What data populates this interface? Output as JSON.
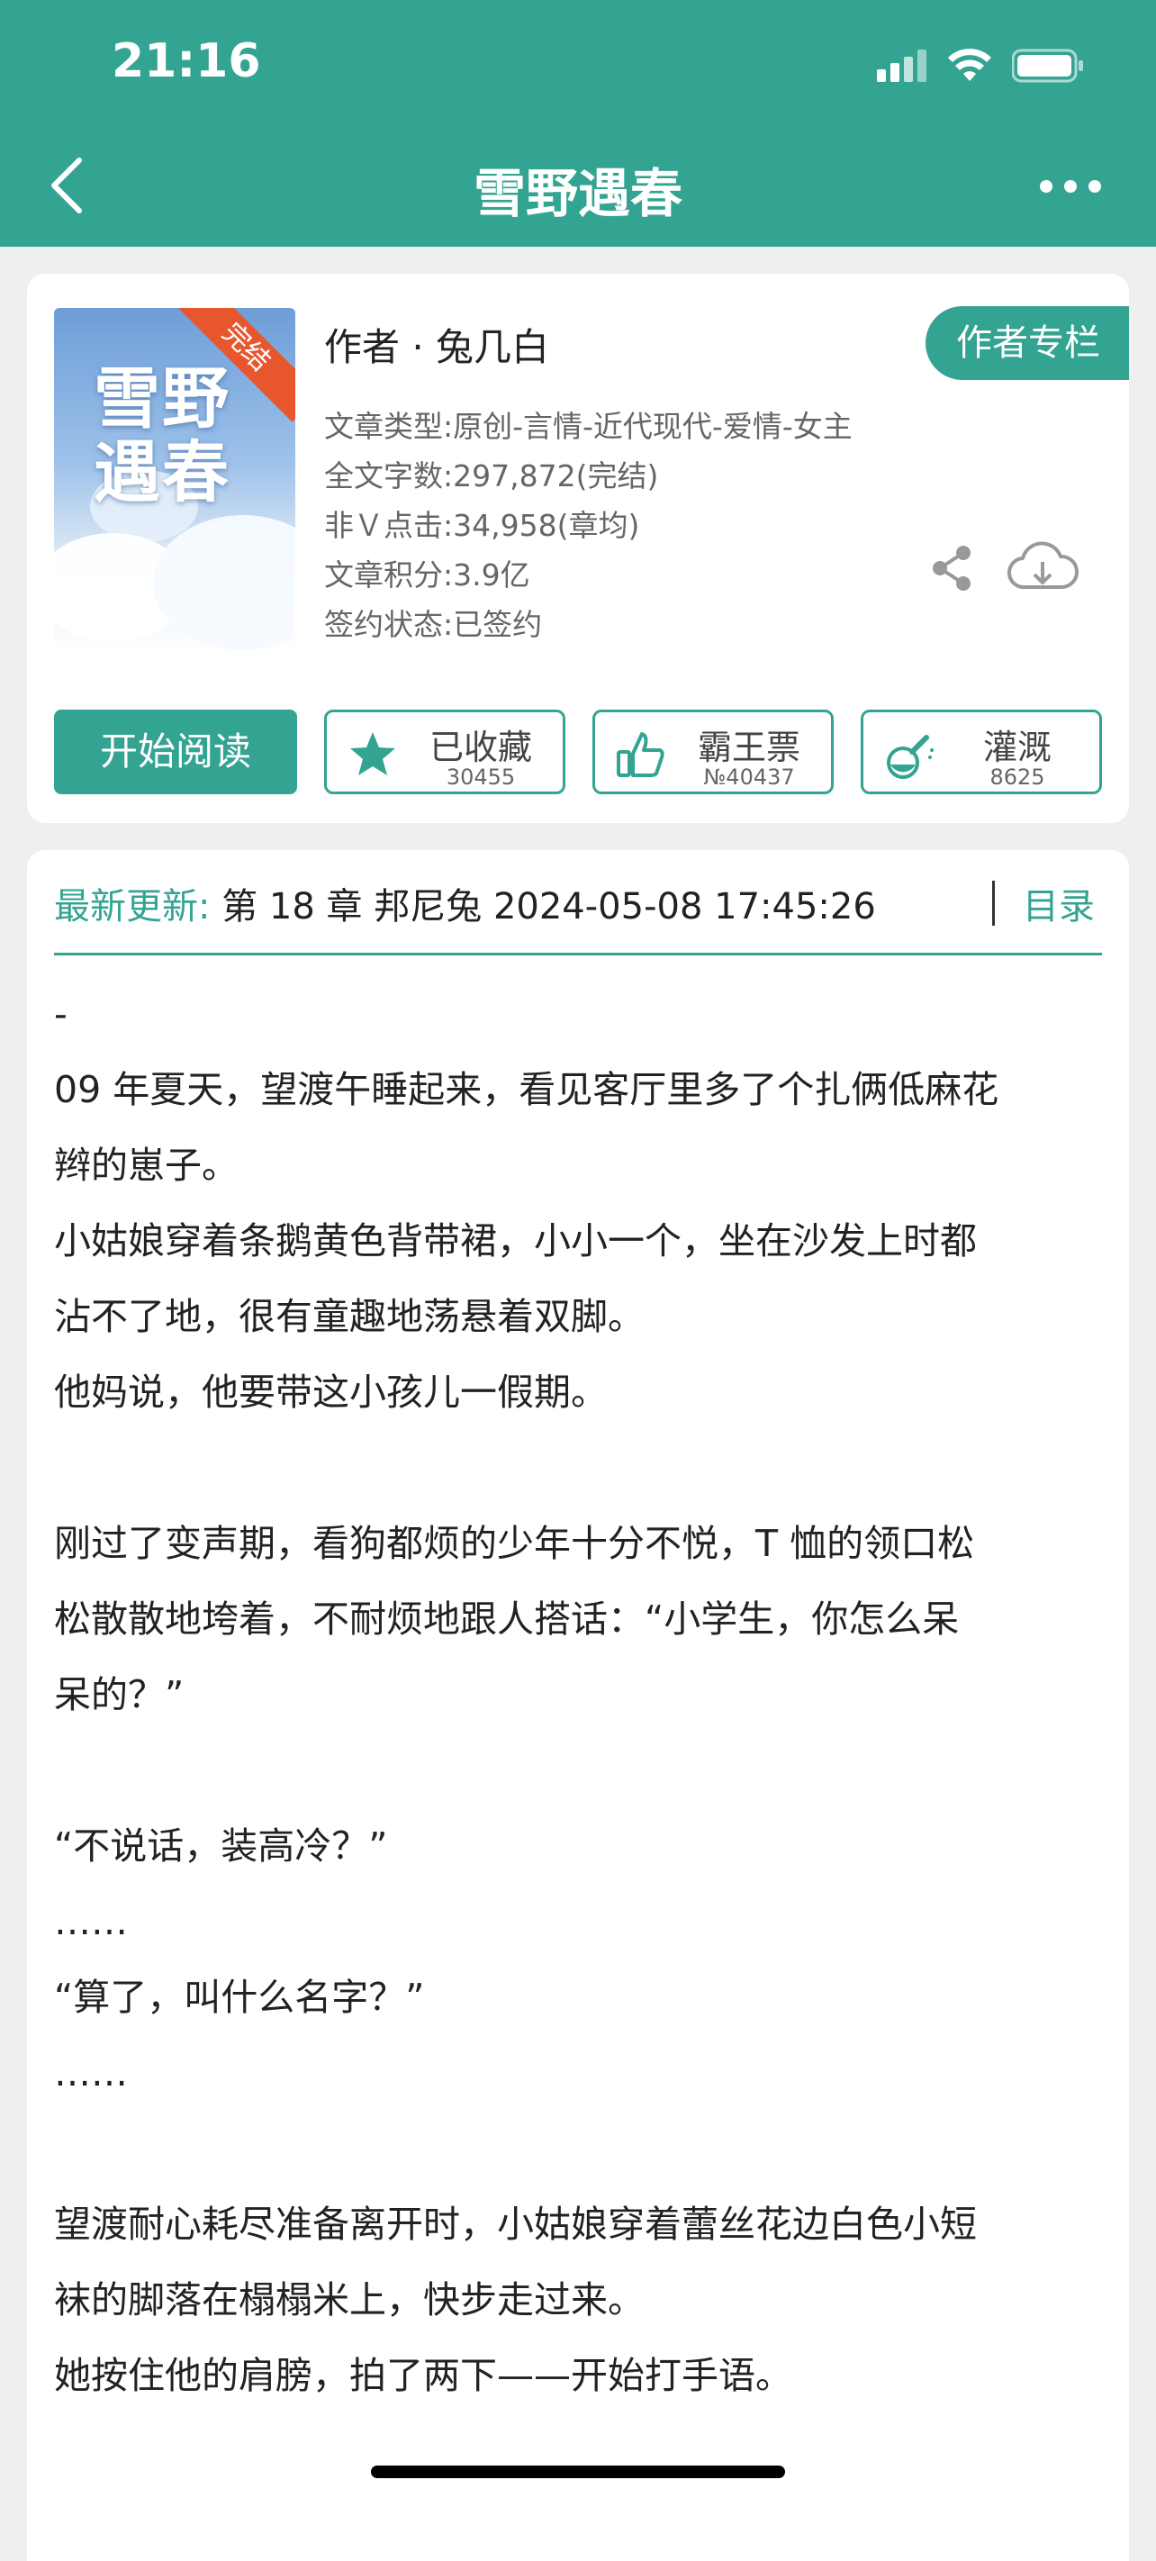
{
  "status_bar": {
    "time": "21:16",
    "signal_icon": "cellular-signal-icon",
    "wifi_icon": "wifi-icon",
    "battery_icon": "battery-icon"
  },
  "nav": {
    "title": "雪野遇春",
    "back_icon": "chevron-left-icon",
    "more_icon": "more-dots-icon"
  },
  "book": {
    "cover": {
      "title_art": "雪野遇春",
      "badge": "完结"
    },
    "author": "作者 · 兔几白",
    "author_column_button": "作者专栏",
    "meta": [
      "文章类型:原创-言情-近代现代-爱情-女主",
      "全文字数:297,872(完结)",
      "非Ｖ点击:34,958(章均)",
      "文章积分:3.9亿",
      "签约状态:已签约"
    ],
    "share_icon": "share-icon",
    "download_icon": "cloud-download-icon"
  },
  "actions": {
    "start_reading": "开始阅读",
    "collect": {
      "label": "已收藏",
      "count": "30455",
      "icon": "star-icon"
    },
    "vote": {
      "label": "霸王票",
      "count": "№40437",
      "icon": "thumbs-up-icon"
    },
    "water": {
      "label": "灌溉",
      "count": "8625",
      "icon": "watering-flask-icon"
    }
  },
  "update": {
    "label": "最新更新:",
    "text": " 第 18 章 邦尼兔 2024-05-08 17:45:26",
    "toc": "目录"
  },
  "content": {
    "lines": [
      "-",
      "09 年夏天，望渡午睡起来，看见客厅里多了个扎俩低麻花",
      "辫的崽子。",
      "小姑娘穿着条鹅黄色背带裙，小小一个，坐在沙发上时都",
      "沾不了地，很有童趣地荡悬着双脚。",
      "他妈说，他要带这小孩儿一假期。",
      "",
      "刚过了变声期，看狗都烦的少年十分不悦，T 恤的领口松",
      "松散散地垮着，不耐烦地跟人搭话：“小学生，你怎么呆",
      "呆的？”",
      "",
      "“不说话，装高冷？”",
      "……",
      "“算了，叫什么名字？”",
      "……",
      "",
      "望渡耐心耗尽准备离开时，小姑娘穿着蕾丝花边白色小短",
      "袜的脚落在榻榻米上，快步走过来。",
      "她按住他的肩膀，拍了两下——开始打手语。"
    ]
  },
  "colors": {
    "accent": "#33a492",
    "badge": "#e8562e",
    "background": "#efefef"
  }
}
